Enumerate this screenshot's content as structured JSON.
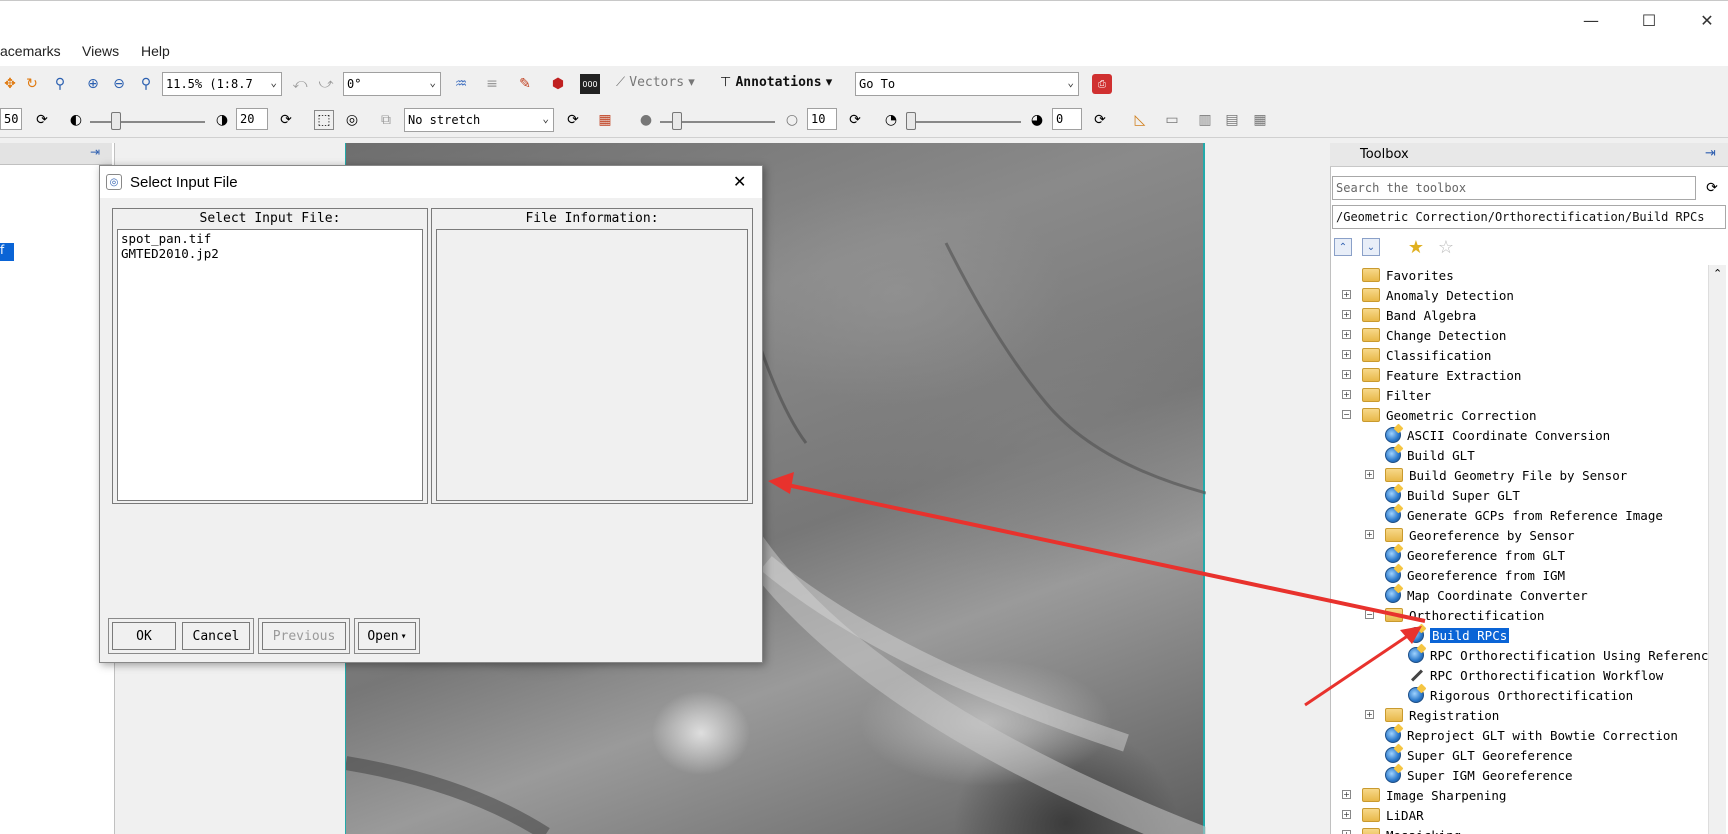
{
  "window": {
    "controls": {
      "minimize": "—",
      "maximize": "☐",
      "close": "✕"
    }
  },
  "menu": {
    "items": [
      "acemarks",
      "Views",
      "Help"
    ]
  },
  "toolbar1": {
    "zoom_value": "11.5% (1:8.7",
    "rotation_value": "0°",
    "vectors_label": "Vectors",
    "annotations_label": "Annotations",
    "goto_value": "Go To"
  },
  "toolbar2": {
    "left_value": "50",
    "contrast_value": "20",
    "stretch_value": "No stretch",
    "sharpen_value": "10",
    "transparency_value": "0"
  },
  "left_panel": {
    "selected_fragment": "f"
  },
  "dialog": {
    "title": "Select Input File",
    "select_header": "Select Input File:",
    "info_header": "File Information:",
    "files": [
      "spot_pan.tif",
      "GMTED2010.jp2"
    ],
    "buttons": {
      "ok": "OK",
      "cancel": "Cancel",
      "previous": "Previous",
      "open": "Open"
    }
  },
  "toolbox": {
    "title": "Toolbox",
    "search_placeholder": "Search the toolbox",
    "path": "/Geometric Correction/Orthorectification/Build RPCs",
    "tree": [
      {
        "label": "Favorites",
        "kind": "folder",
        "level": 0,
        "expander": ""
      },
      {
        "label": "Anomaly Detection",
        "kind": "folder",
        "level": 0,
        "expander": "+"
      },
      {
        "label": "Band Algebra",
        "kind": "folder",
        "level": 0,
        "expander": "+"
      },
      {
        "label": "Change Detection",
        "kind": "folder",
        "level": 0,
        "expander": "+"
      },
      {
        "label": "Classification",
        "kind": "folder",
        "level": 0,
        "expander": "+"
      },
      {
        "label": "Feature Extraction",
        "kind": "folder",
        "level": 0,
        "expander": "+"
      },
      {
        "label": "Filter",
        "kind": "folder",
        "level": 0,
        "expander": "+"
      },
      {
        "label": "Geometric Correction",
        "kind": "folder",
        "level": 0,
        "expander": "−"
      },
      {
        "label": "ASCII Coordinate Conversion",
        "kind": "tool",
        "level": 1,
        "expander": ""
      },
      {
        "label": "Build GLT",
        "kind": "tool",
        "level": 1,
        "expander": ""
      },
      {
        "label": "Build Geometry File by Sensor",
        "kind": "folder",
        "level": 1,
        "expander": "+"
      },
      {
        "label": "Build Super GLT",
        "kind": "tool",
        "level": 1,
        "expander": ""
      },
      {
        "label": "Generate GCPs from Reference Image",
        "kind": "tool",
        "level": 1,
        "expander": ""
      },
      {
        "label": "Georeference by Sensor",
        "kind": "folder",
        "level": 1,
        "expander": "+"
      },
      {
        "label": "Georeference from GLT",
        "kind": "tool",
        "level": 1,
        "expander": ""
      },
      {
        "label": "Georeference from IGM",
        "kind": "tool",
        "level": 1,
        "expander": ""
      },
      {
        "label": "Map Coordinate Converter",
        "kind": "tool",
        "level": 1,
        "expander": ""
      },
      {
        "label": "Orthorectification",
        "kind": "folder",
        "level": 1,
        "expander": "−"
      },
      {
        "label": "Build RPCs",
        "kind": "tool",
        "level": 2,
        "expander": "",
        "selected": true
      },
      {
        "label": "RPC Orthorectification Using Referenc",
        "kind": "tool",
        "level": 2,
        "expander": ""
      },
      {
        "label": "RPC Orthorectification Workflow",
        "kind": "wand",
        "level": 2,
        "expander": ""
      },
      {
        "label": "Rigorous Orthorectification",
        "kind": "tool",
        "level": 2,
        "expander": ""
      },
      {
        "label": "Registration",
        "kind": "folder",
        "level": 1,
        "expander": "+"
      },
      {
        "label": "Reproject GLT with Bowtie Correction",
        "kind": "tool",
        "level": 1,
        "expander": ""
      },
      {
        "label": "Super GLT Georeference",
        "kind": "tool",
        "level": 1,
        "expander": ""
      },
      {
        "label": "Super IGM Georeference",
        "kind": "tool",
        "level": 1,
        "expander": ""
      },
      {
        "label": "Image Sharpening",
        "kind": "folder",
        "level": 0,
        "expander": "+"
      },
      {
        "label": "LiDAR",
        "kind": "folder",
        "level": 0,
        "expander": "+"
      },
      {
        "label": "Mosaicking",
        "kind": "folder",
        "level": 0,
        "expander": "+"
      }
    ]
  },
  "colors": {
    "selection": "#0a64d6",
    "arrow": "#e8322d",
    "image_border": "#22aaaa"
  }
}
